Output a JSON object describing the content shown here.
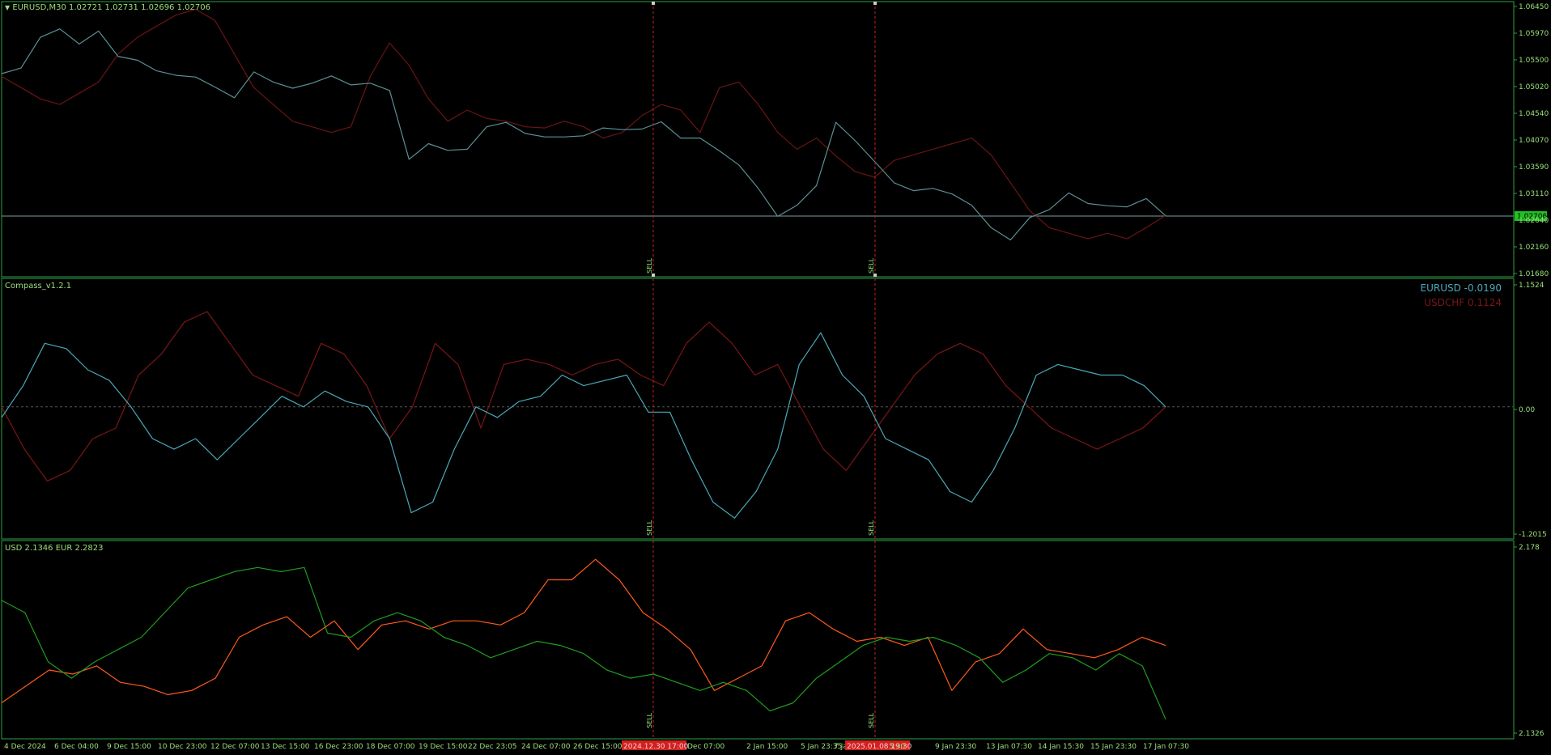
{
  "colors": {
    "background": "#000000",
    "frame": "#2ea043",
    "axis_text": "#9be07a",
    "price_line": "#5b8f95",
    "price_alt": "#6b1414",
    "level_line": "#7f9aa0",
    "eur_line": "#4aa8b8",
    "usdchf_line": "#7a1616",
    "usd_strength": "#1f9d1f",
    "eur_strength": "#ff5a1a",
    "marker": "#d02020",
    "current_price_bg": "#22c022"
  },
  "main_pane": {
    "title": "EURUSD,M30  1.02721 1.02731 1.02696 1.02706",
    "current_price": "1.02706"
  },
  "compass_pane": {
    "title": "Compass_v1.2.1",
    "legend_eur": "EURUSD -0.0190",
    "legend_chf": "USDCHF 0.1124"
  },
  "strength_pane": {
    "title": "USD 2.1346  EUR 2.2823"
  },
  "markers": [
    {
      "label": "SELL",
      "date": "2024.12.30 17:00"
    },
    {
      "label": "SELL",
      "date": "2025.01.08 19:30"
    }
  ],
  "x_axis_labels": [
    "4 Dec 2024",
    "6 Dec 04:00",
    "9 Dec 15:00",
    "10 Dec 23:00",
    "12 Dec 07:00",
    "13 Dec 15:00",
    "16 Dec 23:00",
    "18 Dec 07:00",
    "19 Dec 15:00",
    "22 Dec 23:05",
    "24 Dec 07:00",
    "26 Dec 15:00",
    "2024.12.30 17:00",
    "Dec 07:00",
    "2 Jan 15:00",
    "5 Jan 23:35",
    "7 Jan",
    "2025.01.08 19:30",
    "5:30",
    "9 Jan 23:30",
    "13 Jan 07:30",
    "14 Jan 15:30",
    "15 Jan 23:30",
    "17 Jan 07:30"
  ],
  "chart_data": [
    {
      "type": "line",
      "title": "EURUSD,M30  1.02721 1.02731 1.02696 1.02706",
      "ylim": [
        1.0168,
        1.0645
      ],
      "y_ticks": [
        "1.06450",
        "1.05970",
        "1.05500",
        "1.05020",
        "1.04540",
        "1.04070",
        "1.03590",
        "1.03110",
        "1.02640",
        "1.02160",
        "1.01680"
      ],
      "series": [
        {
          "values": [
            1.0525,
            1.0535,
            1.059,
            1.0605,
            1.0578,
            1.0601,
            1.0556,
            1.0549,
            1.053,
            1.0522,
            1.0519,
            1.0501,
            1.0482,
            1.0528,
            1.051,
            1.0499,
            1.0508,
            1.0521,
            1.0505,
            1.0508,
            1.0495,
            1.0372,
            1.04,
            1.0388,
            1.039,
            1.043,
            1.0438,
            1.0418,
            1.0412,
            1.0412,
            1.0414,
            1.0428,
            1.0425,
            1.0426,
            1.0439,
            1.041,
            1.041,
            1.0387,
            1.0362,
            1.032,
            1.027,
            1.029,
            1.0325,
            1.0438,
            1.0405,
            1.0368,
            1.033,
            1.0316,
            1.032,
            1.031,
            1.029,
            1.025,
            1.0228,
            1.0268,
            1.0282,
            1.0312,
            1.0293,
            1.0289,
            1.0287,
            1.0302,
            1.0271
          ]
        },
        {
          "values": [
            1.052,
            1.05,
            1.048,
            1.047,
            1.049,
            1.051,
            1.056,
            1.059,
            1.061,
            1.063,
            1.064,
            1.062,
            1.056,
            1.05,
            1.047,
            1.044,
            1.043,
            1.042,
            1.043,
            1.052,
            1.058,
            1.054,
            1.048,
            1.044,
            1.046,
            1.0445,
            1.044,
            1.043,
            1.0428,
            1.044,
            1.043,
            1.041,
            1.042,
            1.045,
            1.047,
            1.046,
            1.042,
            1.05,
            1.051,
            1.047,
            1.042,
            1.039,
            1.041,
            1.0378,
            1.035,
            1.034,
            1.037,
            1.038,
            1.039,
            1.04,
            1.041,
            1.038,
            1.033,
            1.028,
            1.025,
            1.024,
            1.023,
            1.024,
            1.023,
            1.025,
            1.0272
          ]
        }
      ]
    },
    {
      "type": "line",
      "title": "Compass_v1.2.1",
      "ylim": [
        -1.2015,
        1.1524
      ],
      "y_ticks": [
        "1.1524",
        "0.00",
        "-1.2015"
      ],
      "series": [
        {
          "name": "EURUSD -0.0190",
          "values": [
            -0.1,
            0.2,
            0.6,
            0.55,
            0.35,
            0.25,
            0.0,
            -0.3,
            -0.4,
            -0.3,
            -0.5,
            -0.3,
            -0.1,
            0.1,
            0.0,
            0.15,
            0.05,
            0.0,
            -0.3,
            -1.0,
            -0.9,
            -0.4,
            0.0,
            -0.1,
            0.05,
            0.1,
            0.3,
            0.2,
            0.25,
            0.3,
            -0.05,
            -0.05,
            -0.5,
            -0.9,
            -1.05,
            -0.8,
            -0.4,
            0.4,
            0.7,
            0.3,
            0.1,
            -0.3,
            -0.4,
            -0.5,
            -0.8,
            -0.9,
            -0.6,
            -0.2,
            0.3,
            0.4,
            0.35,
            0.3,
            0.3,
            0.2,
            0.0
          ]
        },
        {
          "name": "USDCHF 0.1124",
          "values": [
            0.0,
            -0.4,
            -0.7,
            -0.6,
            -0.3,
            -0.2,
            0.3,
            0.5,
            0.8,
            0.9,
            0.6,
            0.3,
            0.2,
            0.1,
            0.6,
            0.5,
            0.2,
            -0.3,
            0.0,
            0.6,
            0.4,
            -0.2,
            0.4,
            0.45,
            0.4,
            0.3,
            0.4,
            0.45,
            0.3,
            0.2,
            0.6,
            0.8,
            0.6,
            0.3,
            0.4,
            0.0,
            -0.4,
            -0.6,
            -0.3,
            0.0,
            0.3,
            0.5,
            0.6,
            0.5,
            0.2,
            0.0,
            -0.2,
            -0.3,
            -0.4,
            -0.3,
            -0.2,
            0.0
          ]
        }
      ]
    },
    {
      "type": "line",
      "title": "USD 2.1346  EUR 2.2823",
      "ylim": [
        2.1326,
        2.178
      ],
      "y_ticks": [
        "2.178",
        "2.1326"
      ],
      "series": [
        {
          "name": "USD",
          "values": [
            2.165,
            2.162,
            2.15,
            2.146,
            2.15,
            2.153,
            2.156,
            2.162,
            2.168,
            2.17,
            2.172,
            2.173,
            2.172,
            2.173,
            2.157,
            2.156,
            2.16,
            2.162,
            2.16,
            2.156,
            2.154,
            2.151,
            2.153,
            2.155,
            2.154,
            2.152,
            2.148,
            2.146,
            2.147,
            2.145,
            2.143,
            2.145,
            2.143,
            2.138,
            2.14,
            2.146,
            2.15,
            2.154,
            2.156,
            2.155,
            2.156,
            2.154,
            2.151,
            2.145,
            2.148,
            2.152,
            2.151,
            2.148,
            2.152,
            2.149,
            2.136
          ]
        },
        {
          "name": "EUR",
          "values": [
            2.14,
            2.144,
            2.148,
            2.147,
            2.149,
            2.145,
            2.144,
            2.142,
            2.143,
            2.146,
            2.156,
            2.159,
            2.161,
            2.156,
            2.16,
            2.153,
            2.159,
            2.16,
            2.158,
            2.16,
            2.16,
            2.159,
            2.162,
            2.17,
            2.17,
            2.175,
            2.17,
            2.162,
            2.158,
            2.153,
            2.143,
            2.146,
            2.149,
            2.16,
            2.162,
            2.158,
            2.155,
            2.156,
            2.154,
            2.156,
            2.143,
            2.15,
            2.152,
            2.158,
            2.153,
            2.152,
            2.151,
            2.153,
            2.156,
            2.154
          ]
        }
      ]
    }
  ]
}
